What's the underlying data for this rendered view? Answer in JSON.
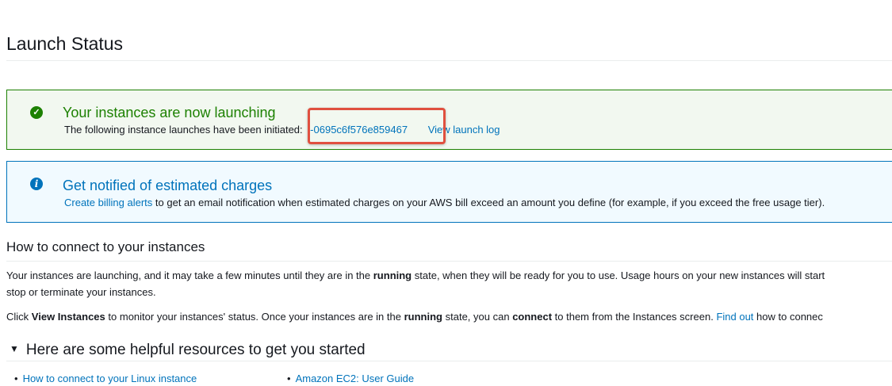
{
  "page": {
    "title": "Launch Status"
  },
  "success_alert": {
    "icon": "check-circle-icon",
    "heading": "Your instances are now launching",
    "body_prefix": "The following instance launches have been initiated:",
    "instance_id": "i-0695c6f576e859467",
    "view_log_link": "View launch log",
    "color": "#1d8102"
  },
  "info_alert": {
    "icon": "info-circle-icon",
    "heading": "Get notified of estimated charges",
    "link": "Create billing alerts",
    "body": "to get an email notification when estimated charges on your AWS bill exceed an amount you define (for example, if you exceed the free usage tier).",
    "color": "#0073bb"
  },
  "connect_section": {
    "heading": "How to connect to your instances",
    "para1": {
      "part1": "Your instances are launching, and it may take a few minutes until they are in the",
      "bold1": "running",
      "part2": "state, when they will be ready for you to use. Usage hours on your new instances will start",
      "line2": "stop or terminate your instances."
    },
    "para2": {
      "part1": "Click",
      "bold1": "View Instances",
      "part2": "to monitor your instances' status. Once your instances are in the",
      "bold2": "running",
      "part3": "state, you can",
      "bold3": "connect",
      "part4": "to them from the Instances screen.",
      "link": "Find out",
      "part5": "how to connec"
    }
  },
  "resources": {
    "heading": "Here are some helpful resources to get you started",
    "links": [
      "How to connect to your Linux instance",
      "Amazon EC2: User Guide"
    ]
  }
}
